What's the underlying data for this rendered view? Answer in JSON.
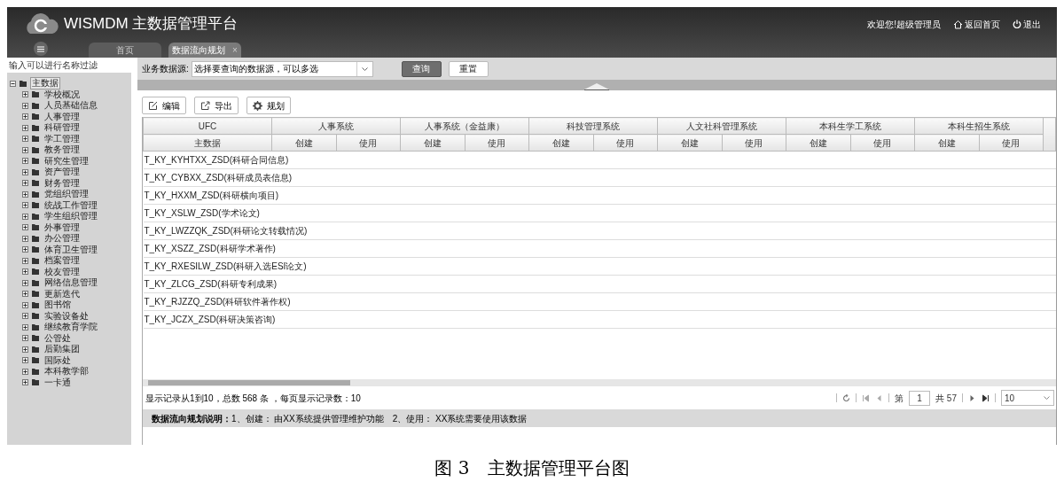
{
  "header": {
    "title": "WISMDM 主数据管理平台",
    "welcome": "欢迎您!超级管理员",
    "links": [
      {
        "kind": "home",
        "label": "返回首页"
      },
      {
        "kind": "logout",
        "label": "退出"
      }
    ]
  },
  "tabs": [
    {
      "label": "首页",
      "selected": false
    },
    {
      "label": "数据流向规划",
      "selected": true,
      "close": "×"
    }
  ],
  "sidebar": {
    "filter": {
      "placeholder": "输入可以进行名称过滤"
    },
    "tree": [
      {
        "label": "主数据",
        "expanded": true,
        "selected": true,
        "children": [
          {
            "label": "学校概况",
            "expanded": false,
            "selected": false
          },
          {
            "label": "人员基础信息",
            "expanded": false,
            "selected": false
          },
          {
            "label": "人事管理",
            "expanded": false,
            "selected": false
          },
          {
            "label": "科研管理",
            "expanded": false,
            "selected": false
          },
          {
            "label": "学工管理",
            "expanded": false,
            "selected": false
          },
          {
            "label": "教务管理",
            "expanded": false,
            "selected": false
          },
          {
            "label": "研究生管理",
            "expanded": false,
            "selected": false
          },
          {
            "label": "资产管理",
            "expanded": false,
            "selected": false
          },
          {
            "label": "财务管理",
            "expanded": false,
            "selected": false
          },
          {
            "label": "党组织管理",
            "expanded": false,
            "selected": false
          },
          {
            "label": "统战工作管理",
            "expanded": false,
            "selected": false
          },
          {
            "label": "学生组织管理",
            "expanded": false,
            "selected": false
          },
          {
            "label": "外事管理",
            "expanded": false,
            "selected": false
          },
          {
            "label": "办公管理",
            "expanded": false,
            "selected": false
          },
          {
            "label": "体育卫生管理",
            "expanded": false,
            "selected": false
          },
          {
            "label": "档案管理",
            "expanded": false,
            "selected": false
          },
          {
            "label": "校友管理",
            "expanded": false,
            "selected": false
          },
          {
            "label": "网络信息管理",
            "expanded": false,
            "selected": false
          },
          {
            "label": "更新迭代",
            "expanded": false,
            "selected": false
          },
          {
            "label": "图书馆",
            "expanded": false,
            "selected": false
          },
          {
            "label": "实验设备处",
            "expanded": false,
            "selected": false
          },
          {
            "label": "继续教育学院",
            "expanded": false,
            "selected": false
          },
          {
            "label": "公管处",
            "expanded": false,
            "selected": false
          },
          {
            "label": "后勤集团",
            "expanded": false,
            "selected": false
          },
          {
            "label": "国际处",
            "expanded": false,
            "selected": false
          },
          {
            "label": "本科教学部",
            "expanded": false,
            "selected": false
          },
          {
            "label": "一卡通",
            "expanded": false,
            "selected": false
          }
        ]
      }
    ]
  },
  "query": {
    "label": "业务数据源:",
    "select": {
      "placeholder": "选择要查询的数据源，可以多选"
    },
    "buttons": [
      {
        "label": "查询",
        "kind": "primary"
      },
      {
        "label": "重置",
        "kind": "default"
      }
    ]
  },
  "toolbar": [
    {
      "kind": "edit",
      "label": "编辑"
    },
    {
      "kind": "export",
      "label": "导出"
    },
    {
      "kind": "plan",
      "label": "规划"
    }
  ],
  "table": {
    "group_headers": [
      "UFC",
      "人事系统",
      "人事系统（金益康）",
      "科技管理系统",
      "人文社科管理系统",
      "本科生学工系统",
      "本科生招生系统"
    ],
    "sub_headers": [
      "主数据",
      "创建",
      "使用",
      "创建",
      "使用",
      "创建",
      "使用",
      "创建",
      "使用",
      "创建",
      "使用",
      "创建",
      "使用"
    ],
    "rows": [
      "T_KY_KYHTXX_ZSD(科研合同信息)",
      "T_KY_CYBXX_ZSD(科研成员表信息)",
      "T_KY_HXXM_ZSD(科研横向项目)",
      "T_KY_XSLW_ZSD(学术论文)",
      "T_KY_LWZZQK_ZSD(科研论文转载情况)",
      "T_KY_XSZZ_ZSD(科研学术著作)",
      "T_KY_RXESILW_ZSD(科研入选ESI论文)",
      "T_KY_ZLCG_ZSD(科研专利成果)",
      "T_KY_RJZZQ_ZSD(科研软件著作权)",
      "T_KY_JCZX_ZSD(科研决策咨询)"
    ]
  },
  "pager": {
    "summary": "显示记录从1到10，总数 568 条 ，每页显示记录数：10",
    "page_label": "第",
    "page": "1",
    "total": "共 57",
    "page_size": "10"
  },
  "note": "**数据流向规划说明：**1、创建： 由XX系统提供管理维护功能　2、使用： XX系统需要使用该数据",
  "caption": "图 3　主数据管理平台图"
}
